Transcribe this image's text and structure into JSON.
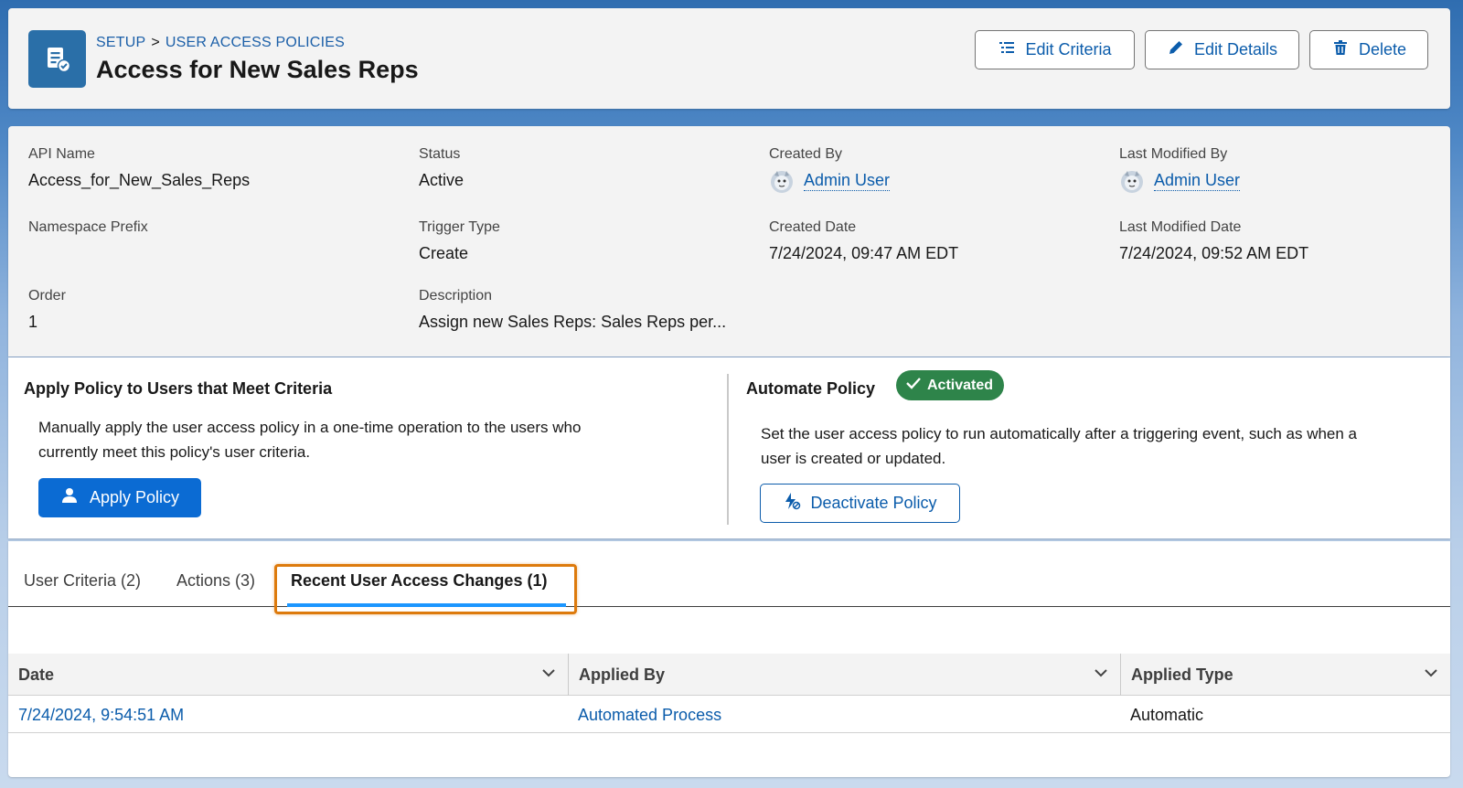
{
  "header": {
    "breadcrumb": [
      "SETUP",
      "USER ACCESS POLICIES"
    ],
    "breadcrumb_sep": ">",
    "title": "Access for New Sales Reps",
    "buttons": {
      "edit_criteria": "Edit Criteria",
      "edit_details": "Edit Details",
      "delete": "Delete"
    }
  },
  "details": {
    "api_name": {
      "label": "API Name",
      "value": "Access_for_New_Sales_Reps"
    },
    "status": {
      "label": "Status",
      "value": "Active"
    },
    "created_by": {
      "label": "Created By",
      "value": "Admin User"
    },
    "last_modified_by": {
      "label": "Last Modified By",
      "value": "Admin User"
    },
    "namespace_prefix": {
      "label": "Namespace Prefix",
      "value": ""
    },
    "trigger_type": {
      "label": "Trigger Type",
      "value": "Create"
    },
    "created_date": {
      "label": "Created Date",
      "value": "7/24/2024, 09:47 AM EDT"
    },
    "last_modified_date": {
      "label": "Last Modified Date",
      "value": "7/24/2024, 09:52 AM EDT"
    },
    "order": {
      "label": "Order",
      "value": "1"
    },
    "description": {
      "label": "Description",
      "value": "Assign new Sales Reps: Sales Reps per..."
    }
  },
  "apply_policy": {
    "title": "Apply Policy to Users that Meet Criteria",
    "text_line1": "Manually apply the user access policy in a one-time operation to the users who",
    "text_line2": "currently meet this policy's user criteria.",
    "button": "Apply Policy"
  },
  "automate_policy": {
    "title": "Automate Policy",
    "badge": "Activated",
    "text_line1": "Set the user access policy to run automatically after a triggering event, such as when a",
    "text_line2": "user is created or updated.",
    "button": "Deactivate Policy"
  },
  "tabs": [
    {
      "label": "User Criteria (2)"
    },
    {
      "label": "Actions (3)"
    },
    {
      "label": "Recent User Access Changes (1)"
    }
  ],
  "table": {
    "columns": [
      "Date",
      "Applied By",
      "Applied Type"
    ],
    "rows": [
      {
        "date": "7/24/2024, 9:54:51 AM",
        "applied_by": "Automated Process",
        "applied_type": "Automatic"
      }
    ]
  },
  "colors": {
    "brand_blue": "#0b5cab",
    "primary_button": "#0b6bd3",
    "success_green": "#2e844a",
    "highlight_orange": "#dd7a0c",
    "tab_underline": "#1b96ff"
  },
  "icons": {
    "header": "policy-doc-check-icon",
    "edit_criteria": "list-icon",
    "edit_details": "pencil-icon",
    "delete": "trash-icon",
    "user": "user-icon",
    "check": "check-icon",
    "deactivate": "flow-off-icon",
    "sort": "chevron-down-icon"
  }
}
